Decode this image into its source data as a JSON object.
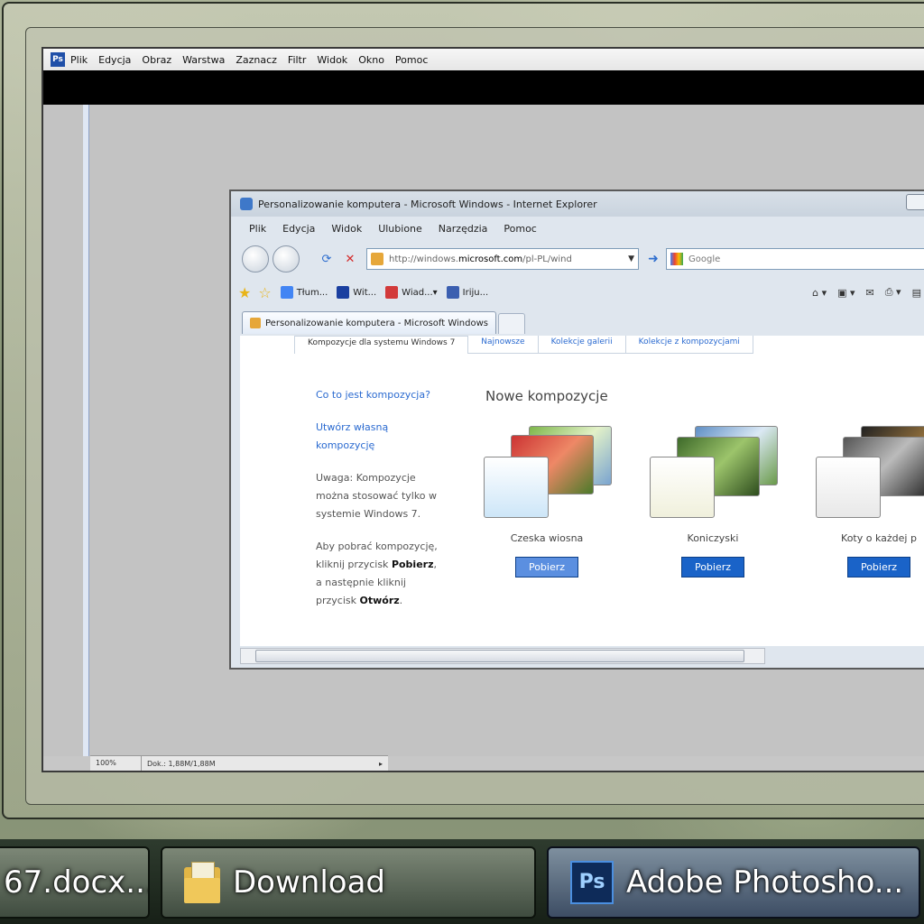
{
  "photoshop": {
    "menu": [
      "Plik",
      "Edycja",
      "Obraz",
      "Warstwa",
      "Zaznacz",
      "Filtr",
      "Widok",
      "Okno",
      "Pomoc"
    ],
    "status_zoom": "100%",
    "status_doc": "Dok.: 1,88M/1,88M"
  },
  "ie": {
    "title": "Personalizowanie komputera - Microsoft Windows - Internet Explorer",
    "menu": [
      "Plik",
      "Edycja",
      "Widok",
      "Ulubione",
      "Narzędzia",
      "Pomoc"
    ],
    "address_prefix": "http://windows.",
    "address_domain": "microsoft.com",
    "address_suffix": "/pl-PL/wind",
    "search_placeholder": "Google",
    "favorites": [
      "Tłum...",
      "Wit...",
      "Wiad...",
      "Iriju..."
    ],
    "tab_label": "Personalizowanie komputera - Microsoft Windows",
    "subtabs": [
      "Kompozycje dla systemu Windows 7",
      "Najnowsze",
      "Kolekcje galerii",
      "Kolekcje z kompozycjami"
    ],
    "sidebar": {
      "link1": "Co to jest kompozycja?",
      "link2": "Utwórz własną kompozycję",
      "note": "Uwaga: Kompozycje można stosować tylko w systemie Windows 7.",
      "howto_pre": "Aby pobrać kompozycję, kliknij przycisk ",
      "howto_b1": "Pobierz",
      "howto_mid": ", a następnie kliknij przycisk ",
      "howto_b2": "Otwórz",
      "howto_end": "."
    },
    "section_title": "Nowe kompozycje",
    "themes": [
      {
        "name": "Czeska wiosna",
        "button": "Pobierz"
      },
      {
        "name": "Koniczyski",
        "button": "Pobierz"
      },
      {
        "name": "Koty o każdej p",
        "button": "Pobierz"
      }
    ]
  },
  "taskbar": {
    "items": [
      "67.docx...",
      "Download",
      "Adobe Photosho..."
    ],
    "ps_icon": "Ps"
  }
}
